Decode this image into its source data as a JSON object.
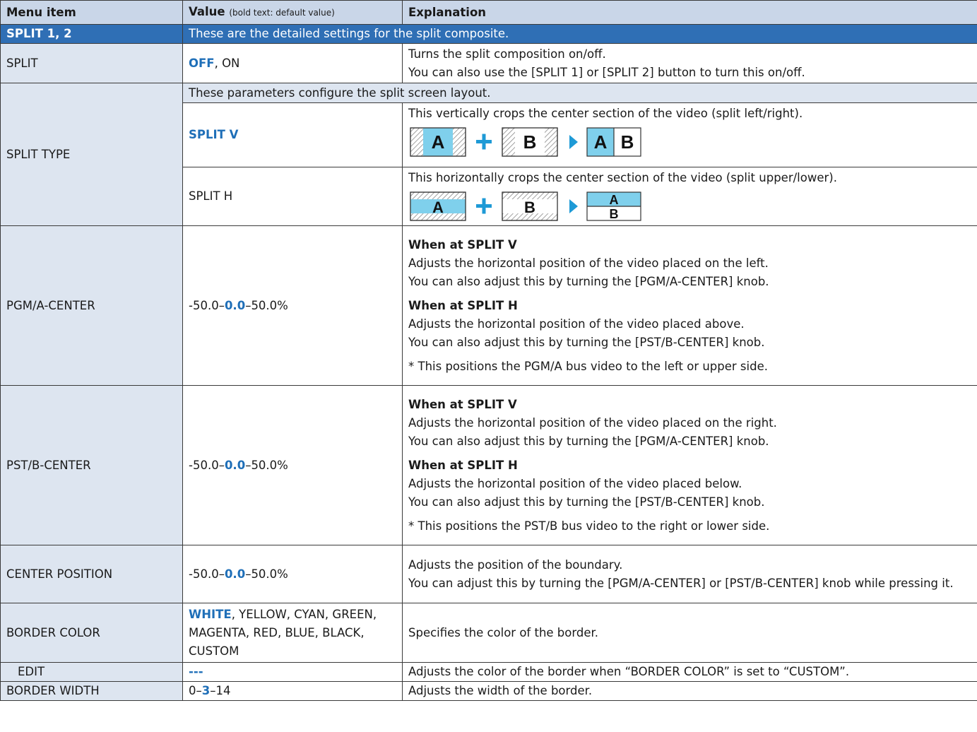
{
  "header": {
    "col1": "Menu item",
    "col2_main": "Value",
    "col2_note": "(bold text: default value)",
    "col3": "Explanation"
  },
  "section": {
    "name": "SPLIT 1, 2",
    "description": "These are the detailed settings for the split composite."
  },
  "rows": {
    "split": {
      "item": "SPLIT",
      "value_default": "OFF",
      "value_rest": ", ON",
      "lines": [
        "Turns the split composition on/off.",
        "You can also use the [SPLIT 1] or [SPLIT 2] button to turn this on/off."
      ]
    },
    "split_type": {
      "item": "SPLIT TYPE",
      "note": "These parameters configure the split screen layout.",
      "v_value": "SPLIT V",
      "v_desc": "This vertically crops the center section of the video (split left/right).",
      "h_value": "SPLIT H",
      "h_desc": "This horizontally crops the center section of the video (split upper/lower).",
      "label_a": "A",
      "label_b": "B"
    },
    "pgm": {
      "item": "PGM/A-CENTER",
      "value_pre": "-50.0–",
      "value_default": "0.0",
      "value_post": "–50.0%",
      "v_head": "When at SPLIT V",
      "v_lines": [
        "Adjusts the horizontal position of the video placed on the left.",
        "You can also adjust this by turning the [PGM/A-CENTER] knob."
      ],
      "h_head": "When at SPLIT H",
      "h_lines": [
        "Adjusts the horizontal position of the video placed above.",
        "You can also adjust this by turning the [PST/B-CENTER] knob."
      ],
      "note": "* This positions the PGM/A bus video to the left or upper side."
    },
    "pst": {
      "item": "PST/B-CENTER",
      "value_pre": "-50.0–",
      "value_default": "0.0",
      "value_post": "–50.0%",
      "v_head": "When at SPLIT V",
      "v_lines": [
        "Adjusts the horizontal position of the video placed on the right.",
        "You can also adjust this by turning the [PGM/A-CENTER] knob."
      ],
      "h_head": "When at SPLIT H",
      "h_lines": [
        "Adjusts the horizontal position of the video placed below.",
        "You can also adjust this by turning the [PST/B-CENTER] knob."
      ],
      "note": "* This positions the PST/B bus video to the right or lower side."
    },
    "center": {
      "item": "CENTER POSITION",
      "value_pre": "-50.0–",
      "value_default": "0.0",
      "value_post": "–50.0%",
      "line1": "Adjusts the position of the boundary.",
      "line2": "You can adjust this by turning the [PGM/A-CENTER] or [PST/B-CENTER] knob while pressing it."
    },
    "border_color": {
      "item": "BORDER COLOR",
      "value_default": "WHITE",
      "value_rest": ", YELLOW, CYAN, GREEN, MAGENTA, RED, BLUE, BLACK, CUSTOM",
      "desc": "Specifies the color of the border."
    },
    "edit": {
      "item": "EDIT",
      "value": "---",
      "desc": "Adjusts the color of the border when “BORDER COLOR” is set to “CUSTOM”."
    },
    "border_width": {
      "item": "BORDER WIDTH",
      "value_pre": "0–",
      "value_default": "3",
      "value_post": "–14",
      "desc": "Adjusts the width of the border."
    }
  },
  "colors": {
    "section_bar": "#2f6fb5",
    "header_bg": "#c9d6e8",
    "item_bg": "#dde5f0",
    "default_value": "#1f6fb8",
    "diagram_fill": "#7fd0ec",
    "diagram_accent": "#1e9ad6"
  }
}
